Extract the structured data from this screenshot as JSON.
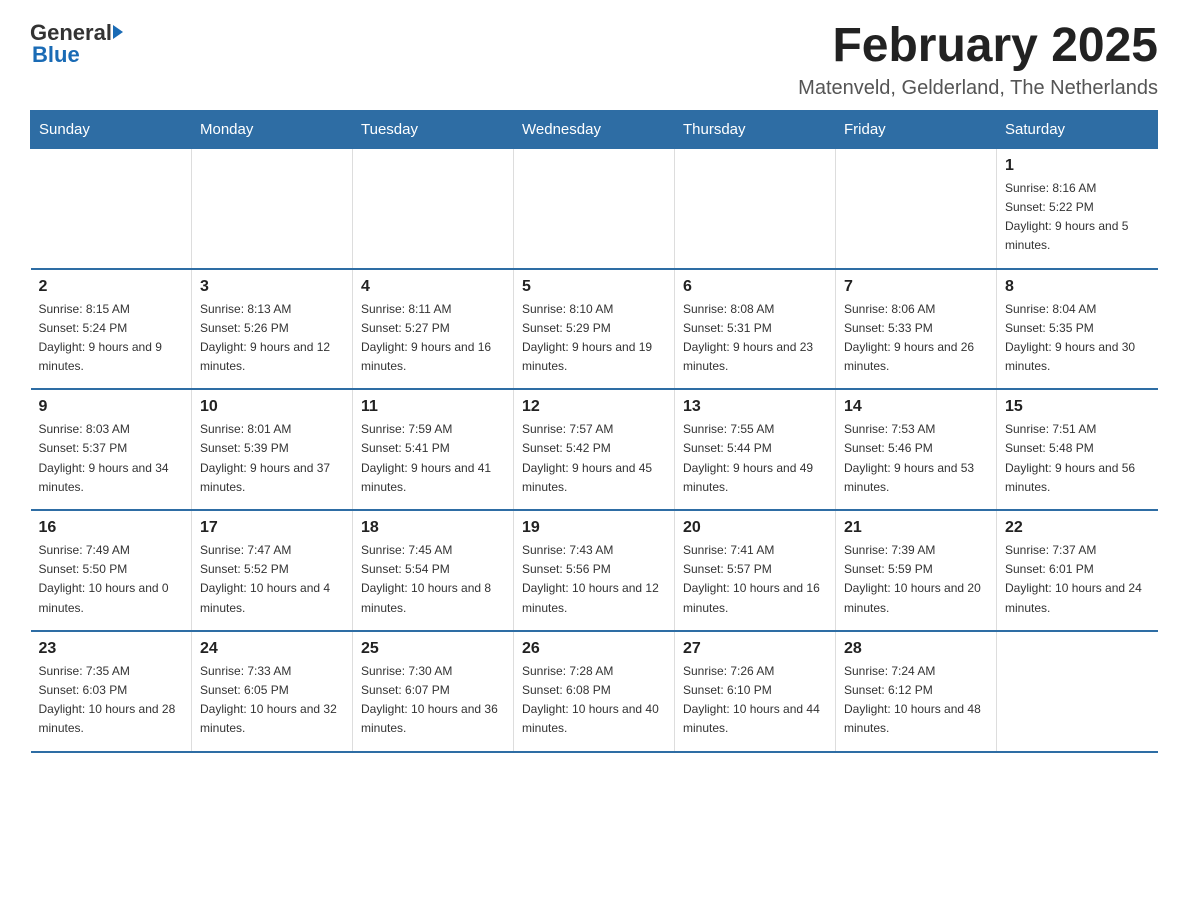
{
  "header": {
    "logo_general": "General",
    "logo_blue": "Blue",
    "title": "February 2025",
    "subtitle": "Matenveld, Gelderland, The Netherlands"
  },
  "days_of_week": [
    "Sunday",
    "Monday",
    "Tuesday",
    "Wednesday",
    "Thursday",
    "Friday",
    "Saturday"
  ],
  "weeks": [
    {
      "days": [
        {
          "number": "",
          "info": ""
        },
        {
          "number": "",
          "info": ""
        },
        {
          "number": "",
          "info": ""
        },
        {
          "number": "",
          "info": ""
        },
        {
          "number": "",
          "info": ""
        },
        {
          "number": "",
          "info": ""
        },
        {
          "number": "1",
          "info": "Sunrise: 8:16 AM\nSunset: 5:22 PM\nDaylight: 9 hours and 5 minutes."
        }
      ]
    },
    {
      "days": [
        {
          "number": "2",
          "info": "Sunrise: 8:15 AM\nSunset: 5:24 PM\nDaylight: 9 hours and 9 minutes."
        },
        {
          "number": "3",
          "info": "Sunrise: 8:13 AM\nSunset: 5:26 PM\nDaylight: 9 hours and 12 minutes."
        },
        {
          "number": "4",
          "info": "Sunrise: 8:11 AM\nSunset: 5:27 PM\nDaylight: 9 hours and 16 minutes."
        },
        {
          "number": "5",
          "info": "Sunrise: 8:10 AM\nSunset: 5:29 PM\nDaylight: 9 hours and 19 minutes."
        },
        {
          "number": "6",
          "info": "Sunrise: 8:08 AM\nSunset: 5:31 PM\nDaylight: 9 hours and 23 minutes."
        },
        {
          "number": "7",
          "info": "Sunrise: 8:06 AM\nSunset: 5:33 PM\nDaylight: 9 hours and 26 minutes."
        },
        {
          "number": "8",
          "info": "Sunrise: 8:04 AM\nSunset: 5:35 PM\nDaylight: 9 hours and 30 minutes."
        }
      ]
    },
    {
      "days": [
        {
          "number": "9",
          "info": "Sunrise: 8:03 AM\nSunset: 5:37 PM\nDaylight: 9 hours and 34 minutes."
        },
        {
          "number": "10",
          "info": "Sunrise: 8:01 AM\nSunset: 5:39 PM\nDaylight: 9 hours and 37 minutes."
        },
        {
          "number": "11",
          "info": "Sunrise: 7:59 AM\nSunset: 5:41 PM\nDaylight: 9 hours and 41 minutes."
        },
        {
          "number": "12",
          "info": "Sunrise: 7:57 AM\nSunset: 5:42 PM\nDaylight: 9 hours and 45 minutes."
        },
        {
          "number": "13",
          "info": "Sunrise: 7:55 AM\nSunset: 5:44 PM\nDaylight: 9 hours and 49 minutes."
        },
        {
          "number": "14",
          "info": "Sunrise: 7:53 AM\nSunset: 5:46 PM\nDaylight: 9 hours and 53 minutes."
        },
        {
          "number": "15",
          "info": "Sunrise: 7:51 AM\nSunset: 5:48 PM\nDaylight: 9 hours and 56 minutes."
        }
      ]
    },
    {
      "days": [
        {
          "number": "16",
          "info": "Sunrise: 7:49 AM\nSunset: 5:50 PM\nDaylight: 10 hours and 0 minutes."
        },
        {
          "number": "17",
          "info": "Sunrise: 7:47 AM\nSunset: 5:52 PM\nDaylight: 10 hours and 4 minutes."
        },
        {
          "number": "18",
          "info": "Sunrise: 7:45 AM\nSunset: 5:54 PM\nDaylight: 10 hours and 8 minutes."
        },
        {
          "number": "19",
          "info": "Sunrise: 7:43 AM\nSunset: 5:56 PM\nDaylight: 10 hours and 12 minutes."
        },
        {
          "number": "20",
          "info": "Sunrise: 7:41 AM\nSunset: 5:57 PM\nDaylight: 10 hours and 16 minutes."
        },
        {
          "number": "21",
          "info": "Sunrise: 7:39 AM\nSunset: 5:59 PM\nDaylight: 10 hours and 20 minutes."
        },
        {
          "number": "22",
          "info": "Sunrise: 7:37 AM\nSunset: 6:01 PM\nDaylight: 10 hours and 24 minutes."
        }
      ]
    },
    {
      "days": [
        {
          "number": "23",
          "info": "Sunrise: 7:35 AM\nSunset: 6:03 PM\nDaylight: 10 hours and 28 minutes."
        },
        {
          "number": "24",
          "info": "Sunrise: 7:33 AM\nSunset: 6:05 PM\nDaylight: 10 hours and 32 minutes."
        },
        {
          "number": "25",
          "info": "Sunrise: 7:30 AM\nSunset: 6:07 PM\nDaylight: 10 hours and 36 minutes."
        },
        {
          "number": "26",
          "info": "Sunrise: 7:28 AM\nSunset: 6:08 PM\nDaylight: 10 hours and 40 minutes."
        },
        {
          "number": "27",
          "info": "Sunrise: 7:26 AM\nSunset: 6:10 PM\nDaylight: 10 hours and 44 minutes."
        },
        {
          "number": "28",
          "info": "Sunrise: 7:24 AM\nSunset: 6:12 PM\nDaylight: 10 hours and 48 minutes."
        },
        {
          "number": "",
          "info": ""
        }
      ]
    }
  ]
}
